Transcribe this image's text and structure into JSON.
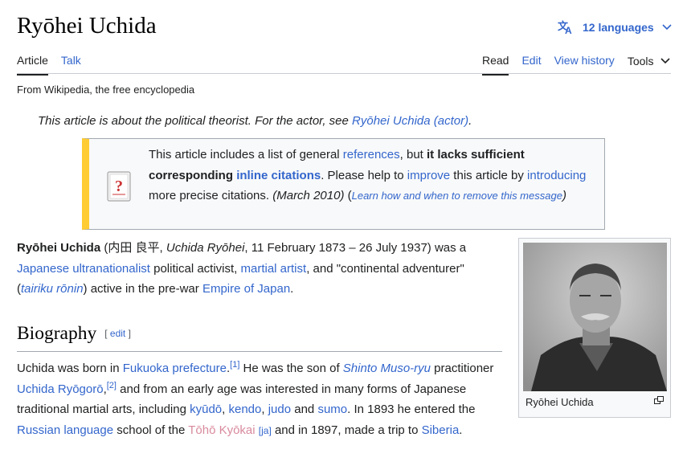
{
  "header": {
    "title": "Ryōhei Uchida",
    "languages_label": "12 languages"
  },
  "tabs": {
    "article": "Article",
    "talk": "Talk",
    "read": "Read",
    "edit": "Edit",
    "view_history": "View history",
    "tools": "Tools"
  },
  "tagline": "From Wikipedia, the free encyclopedia",
  "hatnote": {
    "prefix": "This article is about the political theorist. For the actor, see ",
    "link": "Ryōhei Uchida (actor)",
    "suffix": "."
  },
  "ambox": {
    "t1": "This article includes a list of general ",
    "l1": "references",
    "t2": ", but ",
    "b1": "it lacks sufficient corresponding ",
    "l2": "inline citations",
    "t3": ". Please help to ",
    "l3": "improve",
    "t4": " this article by ",
    "l4": "introducing",
    "t5": " more precise citations. ",
    "date": "(March 2010)",
    "t6": " (",
    "l5": "Learn how and when to remove this message",
    "t7": ")"
  },
  "lead": {
    "name": "Ryōhei Uchida",
    "t1": " (内田 良平, ",
    "romaji": "Uchida Ryōhei",
    "t2": ", 11 February 1873 – 26 July 1937) was a ",
    "l1": "Japanese ultranationalist",
    "t3": " political activist, ",
    "l2": "martial artist",
    "t4": ", and \"continental adventurer\" (",
    "l3": "tairiku rōnin",
    "t5": ") active in the pre-war ",
    "l4": "Empire of Japan",
    "t6": "."
  },
  "infobox": {
    "caption": "Ryōhei Uchida"
  },
  "biography": {
    "heading": "Biography",
    "edit_open": "[ ",
    "edit_label": "edit",
    "edit_close": " ]",
    "t1": "Uchida was born in ",
    "l1": "Fukuoka prefecture",
    "t2": ".",
    "ref1": "[1]",
    "t3": " He was the son of ",
    "l2": "Shinto Muso-ryu",
    "t4": " practitioner ",
    "l3": "Uchida Ryōgorō",
    "t5": ",",
    "ref2": "[2]",
    "t6": " and from an early age was interested in many forms of Japanese traditional martial arts, including ",
    "l4": "kyūdō",
    "t7": ", ",
    "l5": "kendo",
    "t8": ", ",
    "l6": "judo",
    "t9": " and ",
    "l7": "sumo",
    "t10": ". In 1893 he entered the ",
    "l8": "Russian language",
    "t11": " school of the ",
    "l9": "Tōhō Kyōkai",
    "t12": " ",
    "ill": "[ja]",
    "t13": " and in 1897, made a trip to ",
    "l10": "Siberia",
    "t14": "."
  },
  "colors": {
    "link": "#3366cc",
    "ambox_border": "#ffcc33",
    "text": "#202122"
  }
}
